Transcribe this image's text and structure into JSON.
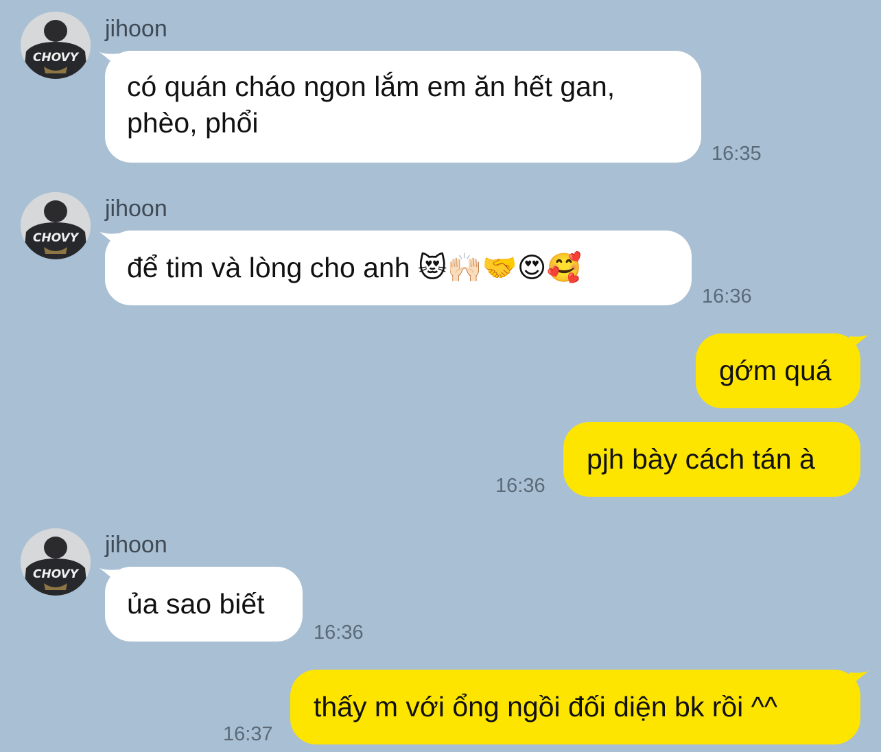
{
  "contact": {
    "name": "jihoon",
    "avatar_text": "CHOVY"
  },
  "colors": {
    "background": "#a9bfd3",
    "incoming_bubble": "#ffffff",
    "outgoing_bubble": "#fee500"
  },
  "messages": [
    {
      "direction": "incoming",
      "sender": "jihoon",
      "text_line1": "có quán cháo ngon lắm em ăn hết gan,",
      "text_line2": "phèo, phổi",
      "time": "16:35"
    },
    {
      "direction": "incoming",
      "sender": "jihoon",
      "text": "để tim và lòng cho anh 😻🙌🏻🤝😍🥰",
      "time": "16:36"
    },
    {
      "direction": "outgoing",
      "text": "gớm quá",
      "time": ""
    },
    {
      "direction": "outgoing",
      "text": "pjh bày cách tán à",
      "time": "16:36"
    },
    {
      "direction": "incoming",
      "sender": "jihoon",
      "text": "ủa sao biết",
      "time": "16:36"
    },
    {
      "direction": "outgoing",
      "text": "thấy m với ổng ngồi đối diện bk rồi ^^",
      "time": "16:37"
    }
  ]
}
